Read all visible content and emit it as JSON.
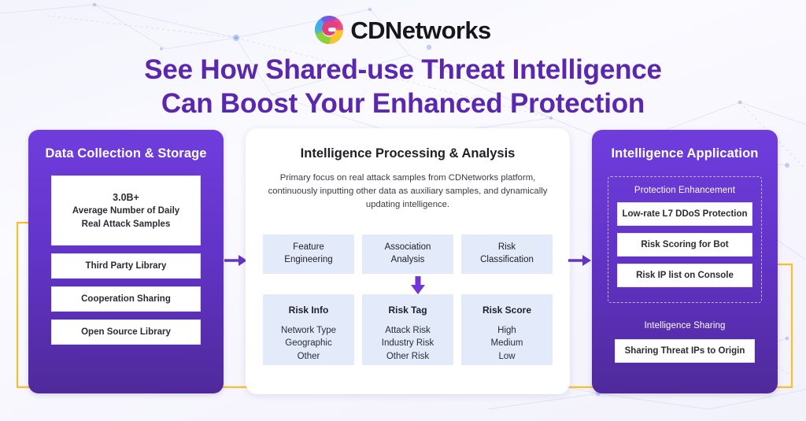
{
  "brand": {
    "name": "CDNetworks",
    "logo_icon": "cdnetworks-swirl-logo-icon",
    "colors": {
      "accent_purple": "#5a27ad",
      "panel_purple": "#6334c9",
      "light_blue": "#e3ebfb",
      "feedback_orange": "#fcbf2b"
    }
  },
  "title": {
    "line1": "See How Shared-use Threat Intelligence",
    "line2": "Can Boost Your Enhanced Protection"
  },
  "panels": {
    "left": {
      "title": "Data Collection & Storage",
      "stat": {
        "value": "3.0B+",
        "label_line1": "Average Number of Daily",
        "label_line2": "Real Attack Samples"
      },
      "items": [
        "Third Party Library",
        "Cooperation Sharing",
        "Open Source Library"
      ]
    },
    "center": {
      "title": "Intelligence Processing & Analysis",
      "description": "Primary focus on real attack samples from CDNetworks platform, continuously inputting other data as auxiliary samples, and dynamically updating intelligence.",
      "row1": [
        {
          "line1": "Feature",
          "line2": "Engineering"
        },
        {
          "line1": "Association",
          "line2": "Analysis"
        },
        {
          "line1": "Risk",
          "line2": "Classification"
        }
      ],
      "row2": [
        {
          "heading": "Risk Info",
          "items": "Network Type\nGeographic\nOther"
        },
        {
          "heading": "Risk Tag",
          "items": "Attack Risk\nIndustry Risk\nOther Risk"
        },
        {
          "heading": "Risk Score",
          "items": "High\nMedium\nLow"
        }
      ],
      "down_arrow_icon": "arrow-down-icon"
    },
    "right": {
      "title": "Intelligence Application",
      "protection_group_label": "Protection Enhancement",
      "protection_items": [
        "Low-rate L7 DDoS Protection",
        "Risk Scoring for Bot",
        "Risk IP list on Console"
      ],
      "sharing_group_label": "Intelligence Sharing",
      "sharing_items": [
        "Sharing Threat IPs to Origin"
      ]
    }
  },
  "connectors": {
    "arrow_left_to_center_icon": "arrow-right-icon",
    "arrow_center_to_right_icon": "arrow-right-icon",
    "feedback_loop_icon": "feedback-loop-arrow-icon"
  }
}
